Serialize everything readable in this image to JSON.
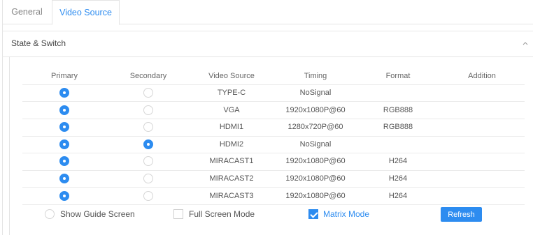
{
  "tabs": [
    {
      "label": "General",
      "active": false
    },
    {
      "label": "Video Source",
      "active": true
    }
  ],
  "section": {
    "title": "State & Switch",
    "collapse_icon": "chevron-up-icon"
  },
  "table": {
    "headers": [
      "Primary",
      "Secondary",
      "Video Source",
      "Timing",
      "Format",
      "Addition"
    ],
    "rows": [
      {
        "primary": true,
        "secondary": false,
        "source": "TYPE-C",
        "timing": "NoSignal",
        "format": "",
        "addition": ""
      },
      {
        "primary": true,
        "secondary": false,
        "source": "VGA",
        "timing": "1920x1080P@60",
        "format": "RGB888",
        "addition": ""
      },
      {
        "primary": true,
        "secondary": false,
        "source": "HDMI1",
        "timing": "1280x720P@60",
        "format": "RGB888",
        "addition": ""
      },
      {
        "primary": true,
        "secondary": true,
        "source": "HDMI2",
        "timing": "NoSignal",
        "format": "",
        "addition": ""
      },
      {
        "primary": true,
        "secondary": false,
        "source": "MIRACAST1",
        "timing": "1920x1080P@60",
        "format": "H264",
        "addition": ""
      },
      {
        "primary": true,
        "secondary": false,
        "source": "MIRACAST2",
        "timing": "1920x1080P@60",
        "format": "H264",
        "addition": ""
      },
      {
        "primary": true,
        "secondary": false,
        "source": "MIRACAST3",
        "timing": "1920x1080P@60",
        "format": "H264",
        "addition": ""
      }
    ]
  },
  "options": {
    "show_guide": {
      "label": "Show Guide Screen",
      "checked": false
    },
    "full_screen": {
      "label": "Full Screen Mode",
      "checked": false
    },
    "matrix_mode": {
      "label": "Matrix Mode",
      "checked": true
    }
  },
  "refresh_label": "Refresh",
  "colors": {
    "accent": "#2d8cf0",
    "border": "#e4e4e4",
    "text": "#555555"
  }
}
